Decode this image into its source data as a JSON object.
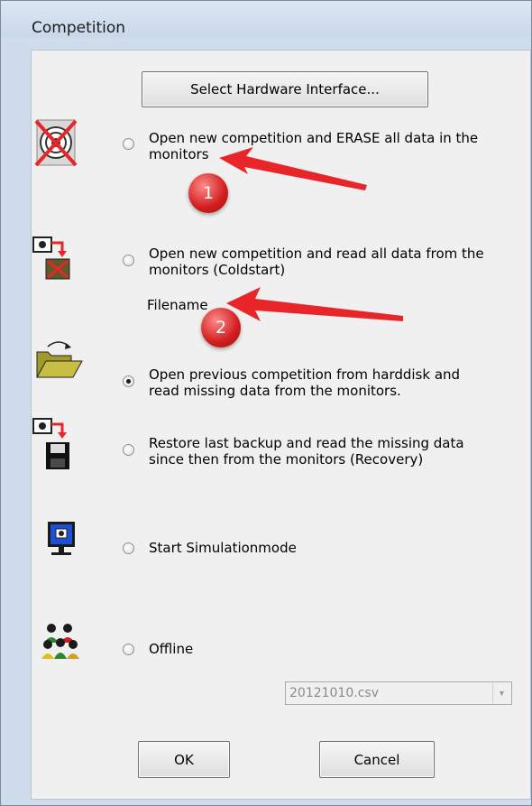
{
  "window": {
    "title": "Competition"
  },
  "buttons": {
    "select_hardware": "Select Hardware Interface...",
    "ok": "OK",
    "cancel": "Cancel"
  },
  "options": [
    {
      "id": "erase",
      "line1": "Open new competition and ERASE all data in the",
      "line2": "monitors",
      "checked": false,
      "icon": "target-erase-icon"
    },
    {
      "id": "coldstart",
      "line1": "Open new competition and read all data from the",
      "line2": "monitors (Coldstart)",
      "checked": false,
      "icon": "monitor-coldstart-icon"
    },
    {
      "id": "previous",
      "line1": "Open previous competition from harddisk and",
      "line2": "read missing data from the monitors.",
      "checked": true,
      "icon": "open-folder-icon"
    },
    {
      "id": "recovery",
      "line1": "Restore last backup and read the missing data",
      "line2": "since then from the monitors (Recovery)",
      "checked": false,
      "icon": "floppy-restore-icon"
    },
    {
      "id": "simulation",
      "line1": "Start Simulationmode",
      "line2": "",
      "checked": false,
      "icon": "computer-screen-icon"
    },
    {
      "id": "offline",
      "line1": "Offline",
      "line2": "",
      "checked": false,
      "icon": "people-group-icon"
    }
  ],
  "filename_label": "Filename",
  "file_combo": {
    "value": "20121010.csv"
  },
  "annotations": [
    {
      "number": "1"
    },
    {
      "number": "2"
    }
  ],
  "colors": {
    "arrow": "#e8262a",
    "badge": "#d11d1d"
  }
}
